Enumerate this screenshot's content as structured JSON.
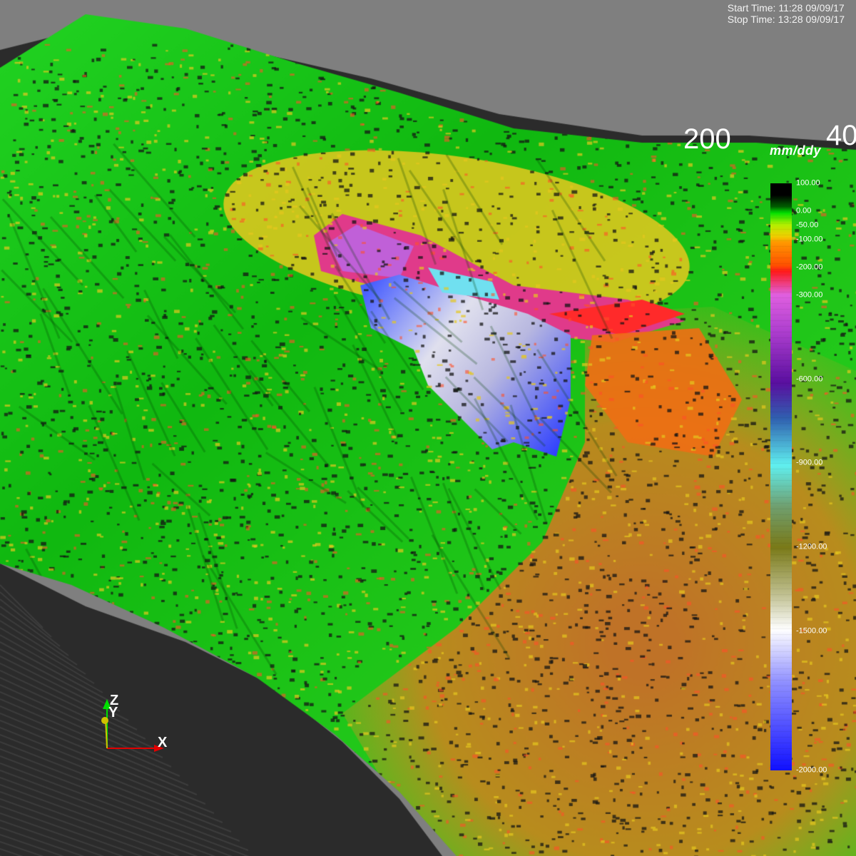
{
  "header": {
    "start_time": "Start Time: 11:28 09/09/17",
    "stop_time": "Stop Time: 13:28 09/09/17"
  },
  "axis_ticks": [
    "200",
    "40"
  ],
  "legend": {
    "units": "mm/ddy",
    "labels": [
      "100.00",
      "0.00",
      "-50.00",
      "-100.00",
      "-200.00",
      "-300.00",
      "-600.00",
      "-900.00",
      "-1200.00",
      "-1500.00",
      "-2000.00"
    ],
    "colors": {
      "top": "#000000",
      "green": "#00e000",
      "yellow_green": "#b0f000",
      "orange": "#ff9a00",
      "red": "#ff1a1a",
      "magenta": "#e060e0",
      "purple": "#5a0fa0",
      "cyan": "#60f0f0",
      "olive": "#7a7a18",
      "white": "#ffffff",
      "blue": "#1010ff"
    }
  },
  "orientation": {
    "z": "Z",
    "y": "Y",
    "x": "X"
  },
  "scene": {
    "background": "#7f7f7f",
    "surface_colors": [
      "#18c418",
      "#2adf10",
      "#0fa80f",
      "#d8c020",
      "#e87c10",
      "#c8a030",
      "#b86030",
      "#2a2a2a",
      "#3a3a3a"
    ]
  }
}
